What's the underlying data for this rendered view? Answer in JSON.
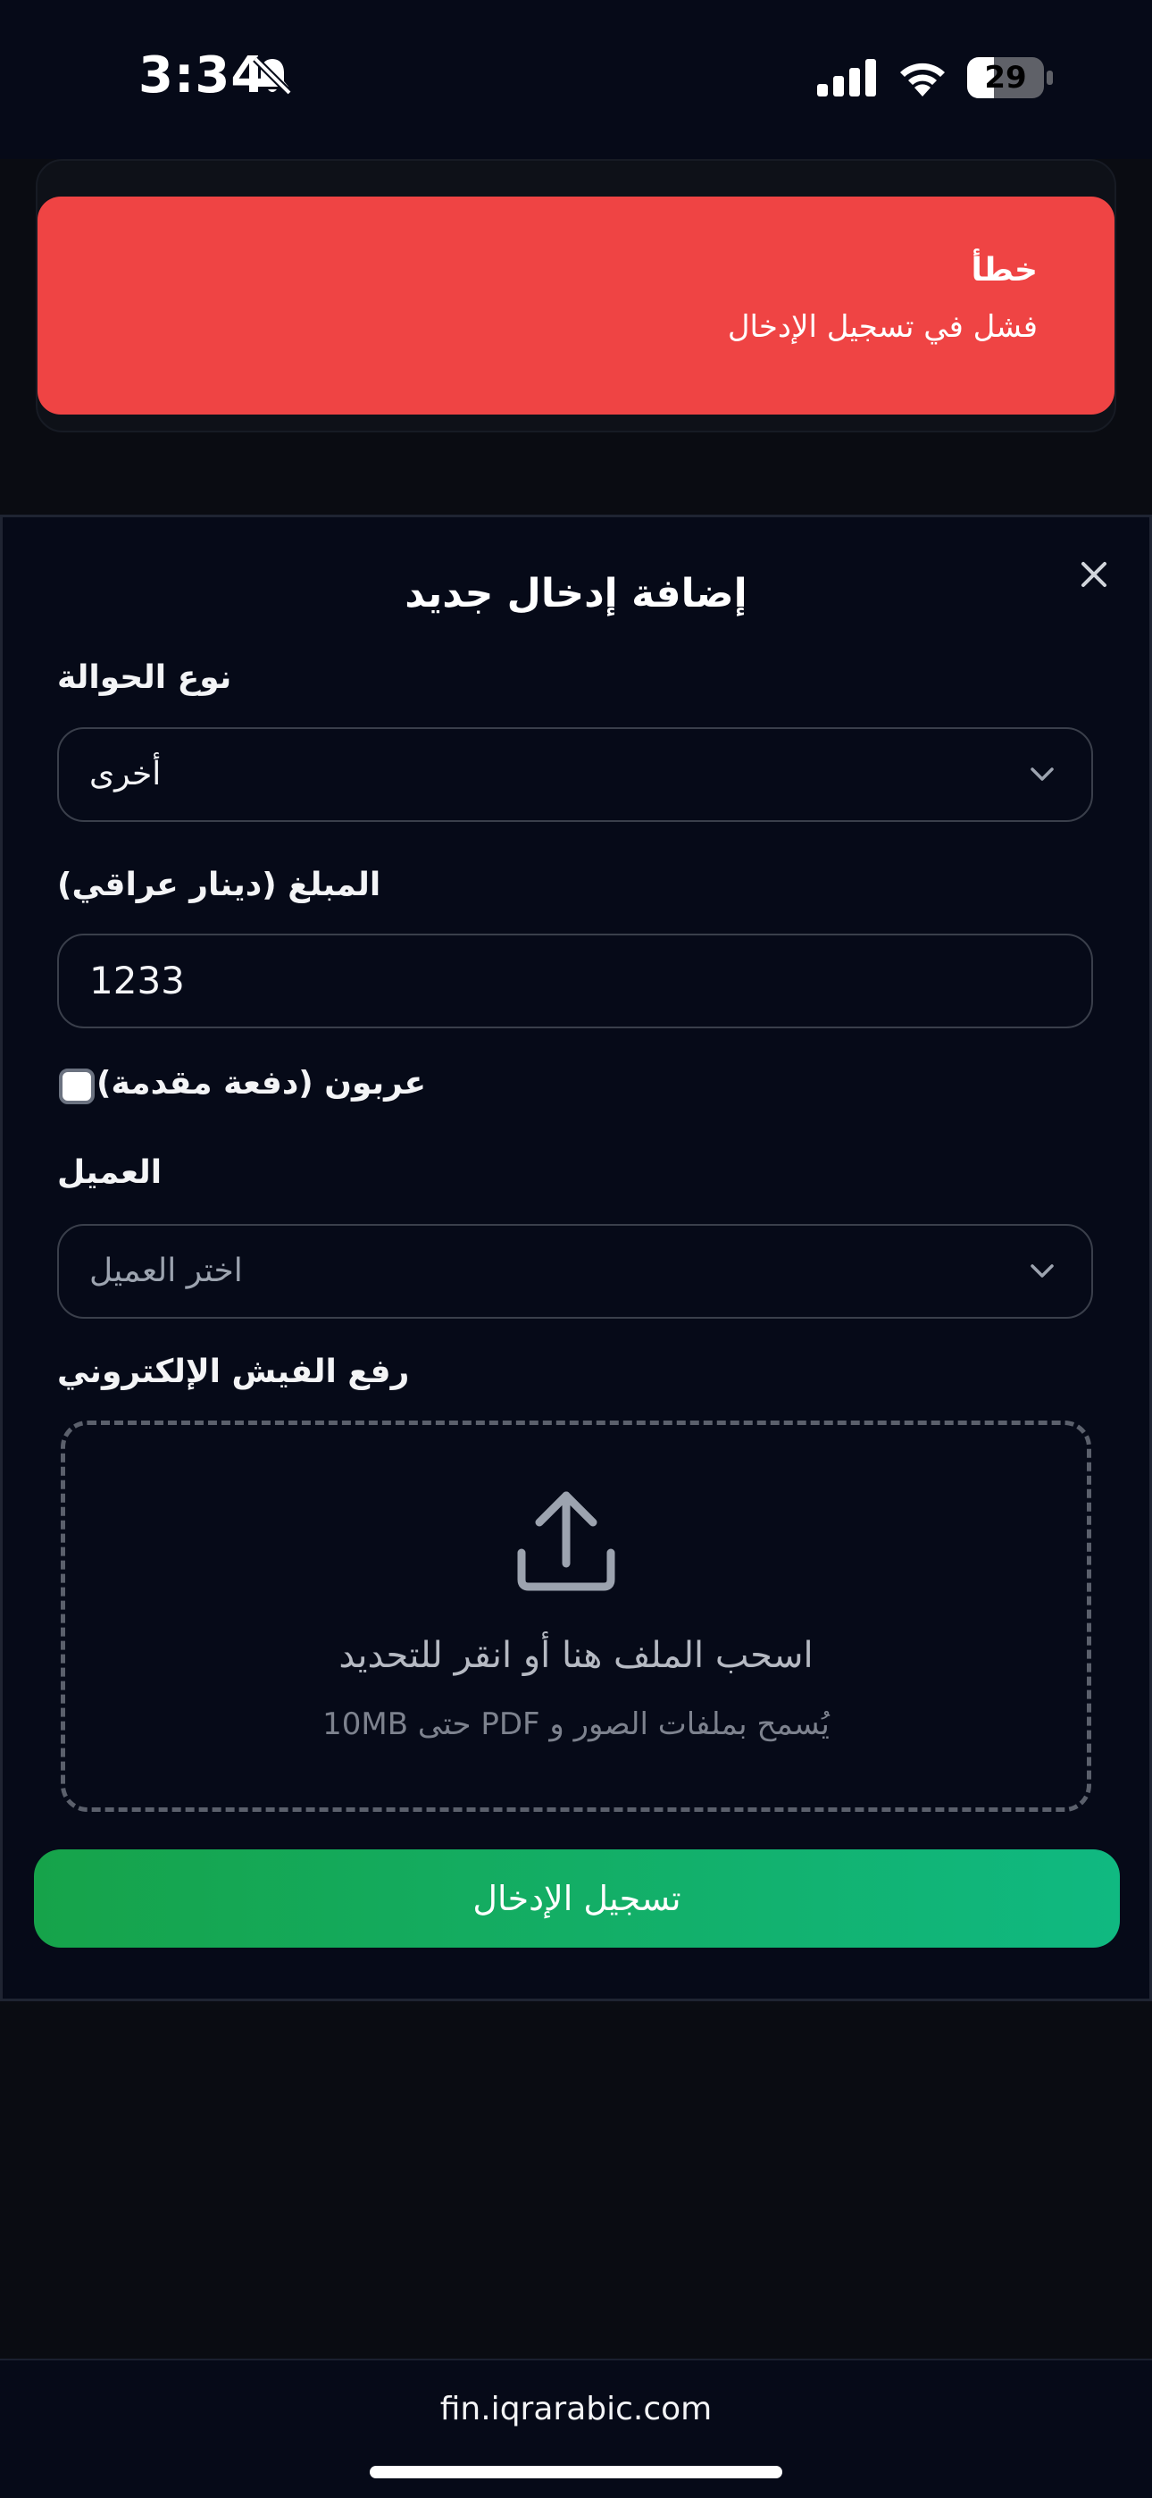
{
  "status_bar": {
    "time": "3:34",
    "battery": "29"
  },
  "toast": {
    "title": "خطأ",
    "message": "فشل في تسجيل الإدخال"
  },
  "modal": {
    "title": "إضافة إدخال جديد",
    "transfer_type": {
      "label": "نوع الحوالة",
      "value": "أخرى"
    },
    "amount": {
      "label": "المبلغ (دينار عراقي)",
      "value": "1233"
    },
    "deposit": {
      "label": "عربون (دفعة مقدمة)",
      "checked": false
    },
    "client": {
      "label": "العميل",
      "placeholder": "اختر العميل"
    },
    "upload": {
      "label": "رفع الفيش الإلكتروني",
      "title": "اسحب الملف هنا أو انقر للتحديد",
      "hint": "يُسمح بملفات الصور و PDF حتى 10MB"
    },
    "submit_label": "تسجيل الإدخال"
  },
  "browser": {
    "url": "fin.iqrarabic.com"
  },
  "colors": {
    "error": "#ef4444",
    "accent_start": "#16a34a",
    "accent_end": "#10b981",
    "background": "#060a18"
  }
}
